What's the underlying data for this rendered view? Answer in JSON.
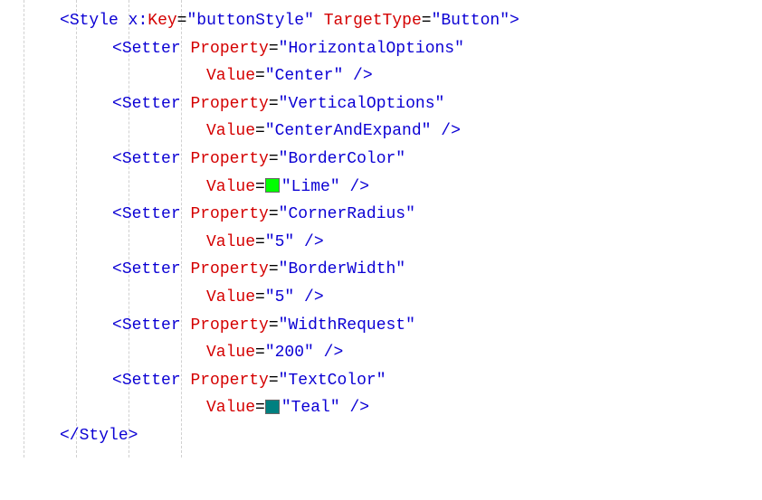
{
  "style": {
    "open_tag": "Style",
    "key_attr": "x",
    "key_attr_colon": ":",
    "key_attr_name": "Key",
    "key_value": "\"buttonStyle\"",
    "target_attr": "TargetType",
    "target_value": "\"Button\"",
    "close_tag": "Style"
  },
  "setters": [
    {
      "prop_attr": "Property",
      "prop_value": "\"HorizontalOptions\"",
      "val_attr": "Value",
      "val_value": "\"Center\"",
      "has_swatch": false
    },
    {
      "prop_attr": "Property",
      "prop_value": "\"VerticalOptions\"",
      "val_attr": "Value",
      "val_value": "\"CenterAndExpand\"",
      "has_swatch": false
    },
    {
      "prop_attr": "Property",
      "prop_value": "\"BorderColor\"",
      "val_attr": "Value",
      "val_value": "\"Lime\"",
      "has_swatch": true,
      "swatch": "lime"
    },
    {
      "prop_attr": "Property",
      "prop_value": "\"CornerRadius\"",
      "val_attr": "Value",
      "val_value": "\"5\"",
      "has_swatch": false
    },
    {
      "prop_attr": "Property",
      "prop_value": "\"BorderWidth\"",
      "val_attr": "Value",
      "val_value": "\"5\"",
      "has_swatch": false
    },
    {
      "prop_attr": "Property",
      "prop_value": "\"WidthRequest\"",
      "val_attr": "Value",
      "val_value": "\"200\"",
      "has_swatch": false
    },
    {
      "prop_attr": "Property",
      "prop_value": "\"TextColor\"",
      "val_attr": "Value",
      "val_value": "\"Teal\"",
      "has_swatch": true,
      "swatch": "teal"
    }
  ],
  "setter_tag": "Setter",
  "lt": "<",
  "gt": ">",
  "slash_gt": " />",
  "lt_slash": "</",
  "eq": "="
}
